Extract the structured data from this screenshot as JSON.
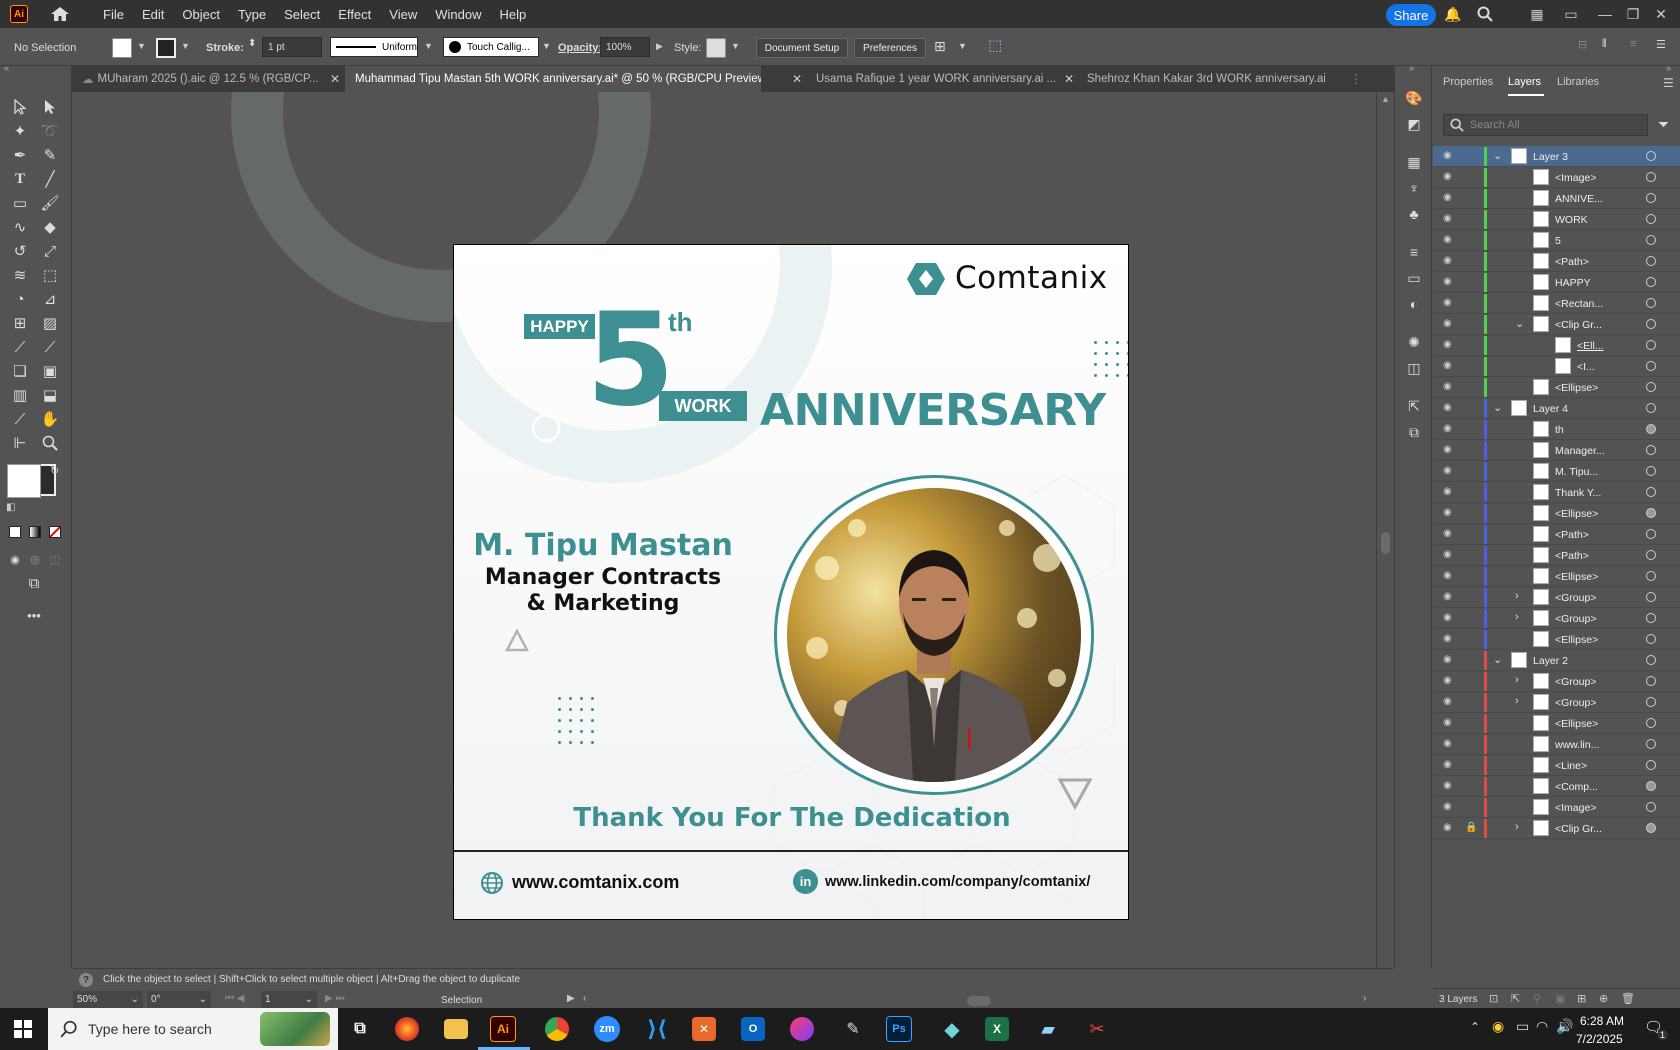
{
  "menubar": {
    "app_logo": "Ai",
    "items": [
      "File",
      "Edit",
      "Object",
      "Type",
      "Select",
      "Effect",
      "View",
      "Window",
      "Help"
    ],
    "share_label": "Share"
  },
  "controlbar": {
    "selection": "No Selection",
    "stroke_label": "Stroke:",
    "stroke_value": "1 pt",
    "stroke_style": "Uniform",
    "brush": "Touch Callig...",
    "opacity_label": "Opacity:",
    "opacity_value": "100%",
    "style_label": "Style:",
    "document_setup": "Document Setup",
    "preferences": "Preferences"
  },
  "tabs": [
    {
      "label": "MUharam 2025 ().aic @ 12.5 % (RGB/CP...",
      "active": false
    },
    {
      "label": "Muhammad Tipu Mastan   5th  WORK anniversary.ai* @ 50 % (RGB/CPU Preview)",
      "active": true
    },
    {
      "label": "Usama Rafique 1 year WORK anniversary.ai ...",
      "active": false
    },
    {
      "label": "Shehroz Khan Kakar   3rd  WORK anniversary.ai",
      "active": false
    }
  ],
  "artwork": {
    "brand": "Comtanix",
    "happy": "HAPPY",
    "number": "5",
    "suffix": "th",
    "work": "WORK",
    "anniversary": "ANNIVERSARY",
    "name": "M. Tipu Mastan",
    "role_line1": "Manager Contracts",
    "role_line2": "& Marketing",
    "thanks": "Thank You For The Dedication",
    "website": "www.comtanix.com",
    "linkedin": "www.linkedin.com/company/comtanix/",
    "linkedin_icon": "in",
    "teal": "#3d8f92"
  },
  "panel": {
    "tabs": [
      "Properties",
      "Layers",
      "Libraries"
    ],
    "search_placeholder": "Search All",
    "layers_count": "3 Layers",
    "rows": [
      {
        "name": "Layer 3",
        "level": 0,
        "color": "#4cd44c",
        "expand": "v",
        "sel": true
      },
      {
        "name": "<Image>",
        "level": 1,
        "color": "#4cd44c"
      },
      {
        "name": "ANNIVE...",
        "level": 1,
        "color": "#4cd44c"
      },
      {
        "name": "WORK",
        "level": 1,
        "color": "#4cd44c"
      },
      {
        "name": "5",
        "level": 1,
        "color": "#4cd44c"
      },
      {
        "name": "<Path>",
        "level": 1,
        "color": "#4cd44c"
      },
      {
        "name": "HAPPY",
        "level": 1,
        "color": "#4cd44c"
      },
      {
        "name": "<Rectan...",
        "level": 1,
        "color": "#4cd44c"
      },
      {
        "name": "<Clip Gr...",
        "level": 1,
        "color": "#4cd44c",
        "expand": "v"
      },
      {
        "name": "<Ell...",
        "level": 2,
        "color": "#4cd44c"
      },
      {
        "name": "<I...",
        "level": 2,
        "color": "#4cd44c"
      },
      {
        "name": "<Ellipse>",
        "level": 1,
        "color": "#4cd44c"
      },
      {
        "name": "Layer 4",
        "level": 0,
        "color": "#4f5ee6",
        "expand": "v"
      },
      {
        "name": "th",
        "level": 1,
        "color": "#4f5ee6",
        "filled": true
      },
      {
        "name": "Manager...",
        "level": 1,
        "color": "#4f5ee6"
      },
      {
        "name": "M. Tipu...",
        "level": 1,
        "color": "#4f5ee6"
      },
      {
        "name": "Thank Y...",
        "level": 1,
        "color": "#4f5ee6"
      },
      {
        "name": "<Ellipse>",
        "level": 1,
        "color": "#4f5ee6",
        "filled": true
      },
      {
        "name": "<Path>",
        "level": 1,
        "color": "#4f5ee6"
      },
      {
        "name": "<Path>",
        "level": 1,
        "color": "#4f5ee6"
      },
      {
        "name": "<Ellipse>",
        "level": 1,
        "color": "#4f5ee6"
      },
      {
        "name": "<Group>",
        "level": 1,
        "color": "#4f5ee6",
        "expand": ">"
      },
      {
        "name": "<Group>",
        "level": 1,
        "color": "#4f5ee6",
        "expand": ">"
      },
      {
        "name": "<Ellipse>",
        "level": 1,
        "color": "#4f5ee6"
      },
      {
        "name": "Layer 2",
        "level": 0,
        "color": "#e04b4b",
        "expand": "v"
      },
      {
        "name": "<Group>",
        "level": 1,
        "color": "#e04b4b",
        "expand": ">"
      },
      {
        "name": "<Group>",
        "level": 1,
        "color": "#e04b4b",
        "expand": ">"
      },
      {
        "name": "<Ellipse>",
        "level": 1,
        "color": "#e04b4b"
      },
      {
        "name": "www.lin...",
        "level": 1,
        "color": "#e04b4b"
      },
      {
        "name": "<Line>",
        "level": 1,
        "color": "#e04b4b"
      },
      {
        "name": "<Comp...",
        "level": 1,
        "color": "#e04b4b",
        "filled": true
      },
      {
        "name": "<Image>",
        "level": 1,
        "color": "#e04b4b"
      },
      {
        "name": "<Clip Gr...",
        "level": 1,
        "color": "#e04b4b",
        "expand": ">",
        "locked": true,
        "filled": true
      }
    ]
  },
  "statusbar": {
    "hint": "Click the object to select  |  Shift+Click to select multiple object  |  Alt+Drag the object to duplicate",
    "zoom": "50%",
    "rotation": "0°",
    "artboard": "1",
    "tool": "Selection"
  },
  "taskbar": {
    "search_placeholder": "Type here to search",
    "time": "6:28 AM",
    "date": "7/2/2025",
    "notif_count": "1"
  }
}
